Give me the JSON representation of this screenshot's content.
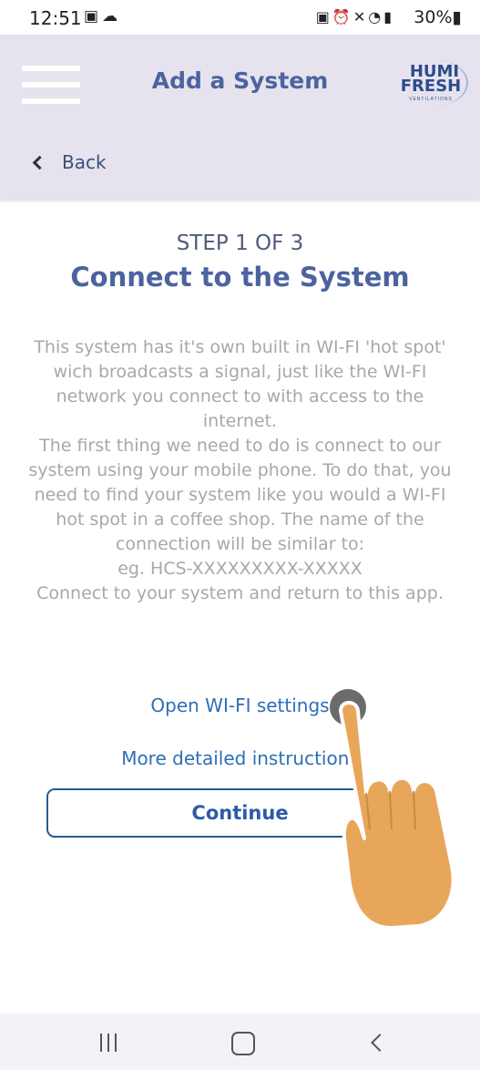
{
  "status_bar": {
    "time": "12:51",
    "left_icons": [
      "gallery-icon",
      "weather-icon"
    ],
    "right_icons": [
      "lock-icon",
      "alarm-icon",
      "mute-icon",
      "wifi-icon",
      "signal-icon"
    ],
    "battery": "30%"
  },
  "header": {
    "title": "Add a System",
    "logo_line1": "HUMI",
    "logo_line2": "FRESH",
    "logo_line3": "VENTILATIONS",
    "back_label": "Back"
  },
  "step": {
    "label": "STEP 1 OF 3",
    "title": "Connect to the System"
  },
  "instructions": {
    "p1": "This system has it's own built in WI-FI 'hot spot' wich broadcasts a signal, just like the WI-FI network you connect to with access to the internet.",
    "p2": "The first thing we need to do is connect to our system using your mobile phone. To do that, you need to find your system like you would a WI-FI hot spot in a coffee shop. The name of the connection will be similar to:",
    "p3": "eg. HCS-XXXXXXXXX-XXXXX",
    "p4": "Connect to your system and return to this app."
  },
  "links": {
    "wifi": "Open WI-FI settings",
    "more": "More detailed instructions"
  },
  "buttons": {
    "continue": "Continue"
  },
  "colors": {
    "accent": "#4c63a0",
    "link": "#2d6fb8",
    "header_bg": "#e6e3ee",
    "hand": "#e8a65b"
  }
}
